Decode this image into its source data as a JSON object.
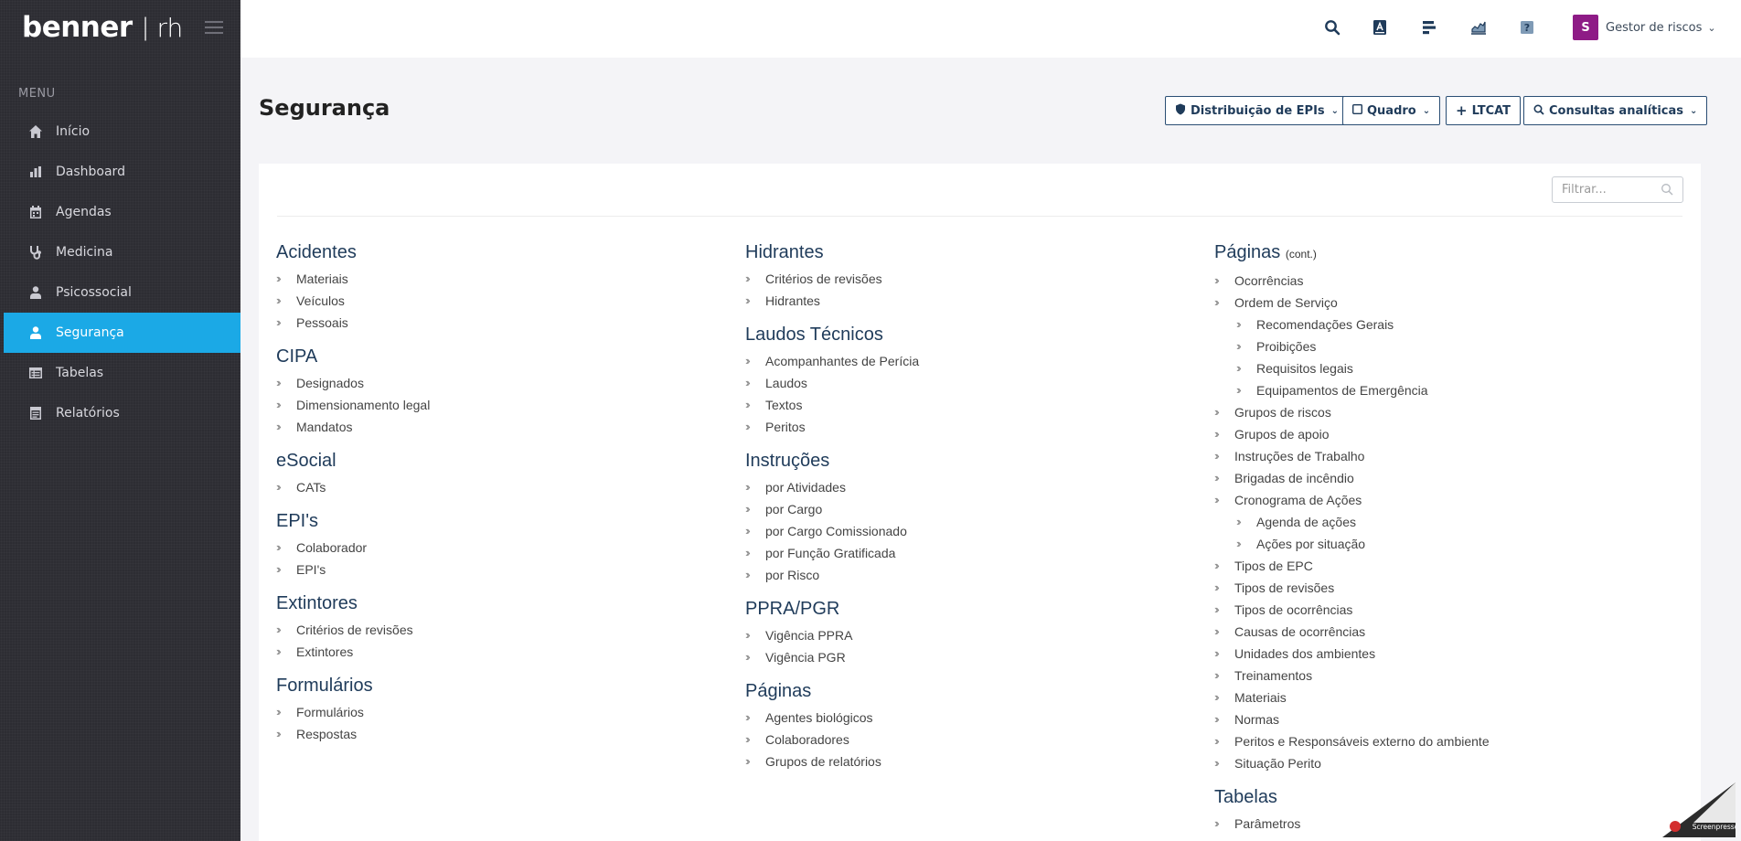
{
  "logo": {
    "brand": "benner",
    "separator": "|",
    "app": "rh"
  },
  "menu_title": "MENU",
  "sidebar": {
    "items": [
      {
        "label": "Início",
        "icon": "home-icon"
      },
      {
        "label": "Dashboard",
        "icon": "bar-chart-icon"
      },
      {
        "label": "Agendas",
        "icon": "calendar-icon"
      },
      {
        "label": "Medicina",
        "icon": "stethoscope-icon"
      },
      {
        "label": "Psicossocial",
        "icon": "person-icon"
      },
      {
        "label": "Segurança",
        "icon": "user-shield-icon",
        "active": true
      },
      {
        "label": "Tabelas",
        "icon": "table-icon"
      },
      {
        "label": "Relatórios",
        "icon": "report-icon"
      }
    ]
  },
  "topbar": {
    "icons": [
      "search-icon",
      "document-a-icon",
      "tasks-icon",
      "analytics-icon",
      "help-icon"
    ],
    "user": {
      "initial": "S",
      "name": "Gestor de riscos"
    }
  },
  "page": {
    "title": "Segurança"
  },
  "actions": {
    "epi": "Distribuição de EPIs",
    "quadro": "Quadro",
    "ltcat": "LTCAT",
    "consultas": "Consultas analíticas"
  },
  "filter": {
    "placeholder": "Filtrar..."
  },
  "columns": [
    [
      {
        "title": "Acidentes",
        "items": [
          {
            "label": "Materiais"
          },
          {
            "label": "Veículos"
          },
          {
            "label": "Pessoais"
          }
        ]
      },
      {
        "title": "CIPA",
        "items": [
          {
            "label": "Designados"
          },
          {
            "label": "Dimensionamento legal"
          },
          {
            "label": "Mandatos"
          }
        ]
      },
      {
        "title": "eSocial",
        "items": [
          {
            "label": "CATs"
          }
        ]
      },
      {
        "title": "EPI's",
        "items": [
          {
            "label": "Colaborador"
          },
          {
            "label": "EPI's"
          }
        ]
      },
      {
        "title": "Extintores",
        "items": [
          {
            "label": "Critérios de revisões"
          },
          {
            "label": "Extintores"
          }
        ]
      },
      {
        "title": "Formulários",
        "items": [
          {
            "label": "Formulários"
          },
          {
            "label": "Respostas"
          }
        ]
      }
    ],
    [
      {
        "title": "Hidrantes",
        "items": [
          {
            "label": "Critérios de revisões"
          },
          {
            "label": "Hidrantes"
          }
        ]
      },
      {
        "title": "Laudos Técnicos",
        "items": [
          {
            "label": "Acompanhantes de Perícia"
          },
          {
            "label": "Laudos"
          },
          {
            "label": "Textos"
          },
          {
            "label": "Peritos"
          }
        ]
      },
      {
        "title": "Instruções",
        "items": [
          {
            "label": "por Atividades"
          },
          {
            "label": "por Cargo"
          },
          {
            "label": "por Cargo Comissionado"
          },
          {
            "label": "por Função Gratificada"
          },
          {
            "label": "por Risco"
          }
        ]
      },
      {
        "title": "PPRA/PGR",
        "items": [
          {
            "label": "Vigência PPRA"
          },
          {
            "label": "Vigência PGR"
          }
        ]
      },
      {
        "title": "Páginas",
        "items": [
          {
            "label": "Agentes biológicos"
          },
          {
            "label": "Colaboradores"
          },
          {
            "label": "Grupos de relatórios"
          }
        ]
      }
    ],
    [
      {
        "title": "Páginas",
        "note": "(cont.)",
        "items": [
          {
            "label": "Ocorrências"
          },
          {
            "label": "Ordem de Serviço"
          },
          {
            "label": "Recomendações Gerais",
            "sub": true
          },
          {
            "label": "Proibições",
            "sub": true
          },
          {
            "label": "Requisitos legais",
            "sub": true
          },
          {
            "label": "Equipamentos de Emergência",
            "sub": true
          },
          {
            "label": "Grupos de riscos"
          },
          {
            "label": "Grupos de apoio"
          },
          {
            "label": "Instruções de Trabalho"
          },
          {
            "label": "Brigadas de incêndio"
          },
          {
            "label": "Cronograma de Ações"
          },
          {
            "label": "Agenda de ações",
            "sub": true
          },
          {
            "label": "Ações por situação",
            "sub": true
          },
          {
            "label": "Tipos de EPC"
          },
          {
            "label": "Tipos de revisões"
          },
          {
            "label": "Tipos de ocorrências"
          },
          {
            "label": "Causas de ocorrências"
          },
          {
            "label": "Unidades dos ambientes"
          },
          {
            "label": "Treinamentos"
          },
          {
            "label": "Materiais"
          },
          {
            "label": "Normas"
          },
          {
            "label": "Peritos e Responsáveis externo do ambiente"
          },
          {
            "label": "Situação Perito"
          }
        ]
      },
      {
        "title": "Tabelas",
        "items": [
          {
            "label": "Parâmetros"
          }
        ]
      }
    ]
  ],
  "watermark": {
    "text": "Screenpresso"
  }
}
